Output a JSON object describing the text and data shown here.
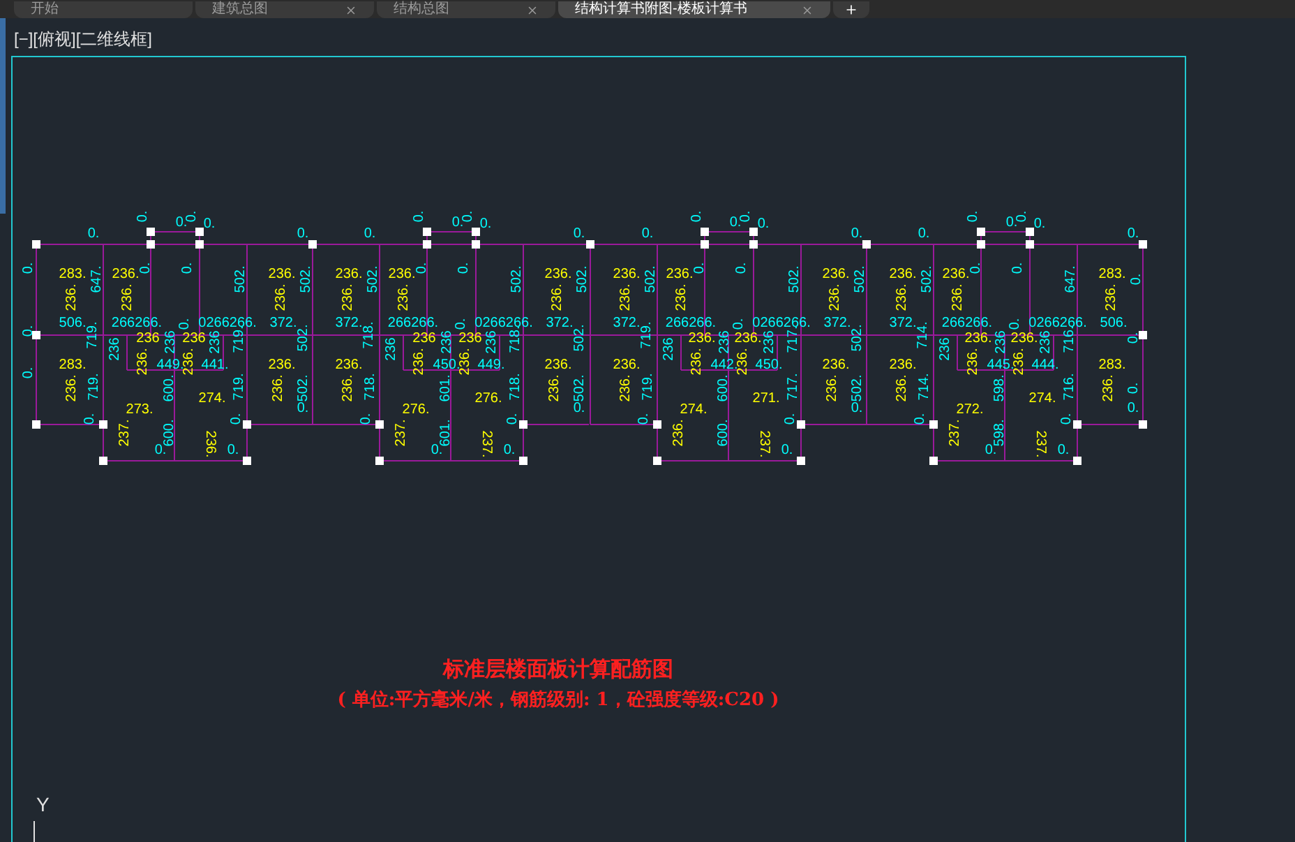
{
  "tabs": [
    {
      "label": "开始",
      "selected": false,
      "closable": false
    },
    {
      "label": "建筑总图",
      "selected": false,
      "closable": true
    },
    {
      "label": "结构总图",
      "selected": false,
      "closable": true
    },
    {
      "label": "结构计算书附图-楼板计算书",
      "selected": true,
      "closable": true
    }
  ],
  "viewport": {
    "label": "[−][俯视][二维线框]"
  },
  "drawing": {
    "units": [
      {
        "labels": [
          {
            "text": "283.",
            "kind": "required"
          },
          {
            "text": "236.",
            "kind": "required"
          },
          {
            "text": "506.",
            "kind": "provided"
          },
          {
            "text": "283.",
            "kind": "required"
          },
          {
            "text": "236.",
            "kind": "required"
          },
          {
            "text": "0.",
            "kind": "provided"
          },
          {
            "text": "647.",
            "kind": "provided"
          },
          {
            "text": "719.",
            "kind": "provided"
          },
          {
            "text": "719.",
            "kind": "provided"
          },
          {
            "text": "0.",
            "kind": "provided"
          },
          {
            "text": "236.",
            "kind": "required"
          },
          {
            "text": "236.",
            "kind": "required"
          },
          {
            "text": "0.",
            "kind": "provided"
          },
          {
            "text": "0.",
            "kind": "provided"
          },
          {
            "text": "0.",
            "kind": "provided"
          },
          {
            "text": "0.",
            "kind": "provided"
          },
          {
            "text": "0.",
            "kind": "provided"
          },
          {
            "text": "0.",
            "kind": "provided"
          },
          {
            "text": "266266.",
            "kind": "provided"
          },
          {
            "text": "0.",
            "kind": "provided"
          },
          {
            "text": "0266266.",
            "kind": "provided"
          },
          {
            "text": "236",
            "kind": "required"
          },
          {
            "text": "236",
            "kind": "required"
          },
          {
            "text": "236",
            "kind": "provided"
          },
          {
            "text": "236",
            "kind": "provided"
          },
          {
            "text": "236",
            "kind": "provided"
          },
          {
            "text": "236.",
            "kind": "required"
          },
          {
            "text": "449.",
            "kind": "provided"
          },
          {
            "text": "236.",
            "kind": "required"
          },
          {
            "text": "441.",
            "kind": "provided"
          },
          {
            "text": "600.",
            "kind": "provided"
          },
          {
            "text": "273.",
            "kind": "required"
          },
          {
            "text": "274.",
            "kind": "required"
          },
          {
            "text": "237.",
            "kind": "required"
          },
          {
            "text": "600.",
            "kind": "provided"
          },
          {
            "text": "236.",
            "kind": "required"
          },
          {
            "text": "0.",
            "kind": "provided"
          },
          {
            "text": "0.",
            "kind": "provided"
          },
          {
            "text": "719.",
            "kind": "provided"
          },
          {
            "text": "719.",
            "kind": "provided"
          },
          {
            "text": "0.",
            "kind": "provided"
          },
          {
            "text": "502.",
            "kind": "provided"
          },
          {
            "text": "236.",
            "kind": "required"
          },
          {
            "text": "236.",
            "kind": "required"
          },
          {
            "text": "372.",
            "kind": "provided"
          },
          {
            "text": "236.",
            "kind": "required"
          },
          {
            "text": "236.",
            "kind": "required"
          },
          {
            "text": "502.",
            "kind": "provided"
          },
          {
            "text": "0.",
            "kind": "provided"
          },
          {
            "text": "502.",
            "kind": "provided"
          },
          {
            "text": "502.",
            "kind": "provided"
          },
          {
            "text": "0.",
            "kind": "provided"
          },
          {
            "text": "0.",
            "kind": "provided"
          },
          {
            "text": "0.",
            "kind": "provided"
          },
          {
            "text": "0.",
            "kind": "provided"
          }
        ]
      },
      {
        "labels": [
          {
            "text": "236.",
            "kind": "required"
          },
          {
            "text": "236.",
            "kind": "required"
          },
          {
            "text": "372.",
            "kind": "provided"
          },
          {
            "text": "236.",
            "kind": "required"
          },
          {
            "text": "236.",
            "kind": "required"
          },
          {
            "text": "0.",
            "kind": "provided"
          },
          {
            "text": "502.",
            "kind": "provided"
          },
          {
            "text": "718.",
            "kind": "provided"
          },
          {
            "text": "718.",
            "kind": "provided"
          },
          {
            "text": "0.",
            "kind": "provided"
          },
          {
            "text": "236.",
            "kind": "required"
          },
          {
            "text": "236.",
            "kind": "required"
          },
          {
            "text": "0.",
            "kind": "provided"
          },
          {
            "text": "0.",
            "kind": "provided"
          },
          {
            "text": "0.",
            "kind": "provided"
          },
          {
            "text": "0.",
            "kind": "provided"
          },
          {
            "text": "0.",
            "kind": "provided"
          },
          {
            "text": "0.",
            "kind": "provided"
          },
          {
            "text": "266266.",
            "kind": "provided"
          },
          {
            "text": "0.",
            "kind": "provided"
          },
          {
            "text": "0266266.",
            "kind": "provided"
          },
          {
            "text": "236",
            "kind": "required"
          },
          {
            "text": "236",
            "kind": "required"
          },
          {
            "text": "236",
            "kind": "provided"
          },
          {
            "text": "236",
            "kind": "provided"
          },
          {
            "text": "236",
            "kind": "provided"
          },
          {
            "text": "236.",
            "kind": "required"
          },
          {
            "text": "450.",
            "kind": "provided"
          },
          {
            "text": "236.",
            "kind": "required"
          },
          {
            "text": "449.",
            "kind": "provided"
          },
          {
            "text": "601.",
            "kind": "provided"
          },
          {
            "text": "276.",
            "kind": "required"
          },
          {
            "text": "276.",
            "kind": "required"
          },
          {
            "text": "237.",
            "kind": "required"
          },
          {
            "text": "601.",
            "kind": "provided"
          },
          {
            "text": "237.",
            "kind": "required"
          },
          {
            "text": "0.",
            "kind": "provided"
          },
          {
            "text": "0.",
            "kind": "provided"
          },
          {
            "text": "718.",
            "kind": "provided"
          },
          {
            "text": "718.",
            "kind": "provided"
          },
          {
            "text": "0.",
            "kind": "provided"
          },
          {
            "text": "502.",
            "kind": "provided"
          },
          {
            "text": "236.",
            "kind": "required"
          },
          {
            "text": "236.",
            "kind": "required"
          },
          {
            "text": "372.",
            "kind": "provided"
          },
          {
            "text": "236.",
            "kind": "required"
          },
          {
            "text": "236.",
            "kind": "required"
          },
          {
            "text": "502.",
            "kind": "provided"
          },
          {
            "text": "0.",
            "kind": "provided"
          },
          {
            "text": "502.",
            "kind": "provided"
          },
          {
            "text": "502.",
            "kind": "provided"
          },
          {
            "text": "0.",
            "kind": "provided"
          }
        ]
      },
      {
        "labels": [
          {
            "text": "236.",
            "kind": "required"
          },
          {
            "text": "236.",
            "kind": "required"
          },
          {
            "text": "372.",
            "kind": "provided"
          },
          {
            "text": "236.",
            "kind": "required"
          },
          {
            "text": "236.",
            "kind": "required"
          },
          {
            "text": "0.",
            "kind": "provided"
          },
          {
            "text": "502.",
            "kind": "provided"
          },
          {
            "text": "719.",
            "kind": "provided"
          },
          {
            "text": "719.",
            "kind": "provided"
          },
          {
            "text": "0.",
            "kind": "provided"
          },
          {
            "text": "236.",
            "kind": "required"
          },
          {
            "text": "236.",
            "kind": "required"
          },
          {
            "text": "0.",
            "kind": "provided"
          },
          {
            "text": "0.",
            "kind": "provided"
          },
          {
            "text": "0.",
            "kind": "provided"
          },
          {
            "text": "0.",
            "kind": "provided"
          },
          {
            "text": "0.",
            "kind": "provided"
          },
          {
            "text": "0.",
            "kind": "provided"
          },
          {
            "text": "266266.",
            "kind": "provided"
          },
          {
            "text": "0.",
            "kind": "provided"
          },
          {
            "text": "0266266.",
            "kind": "provided"
          },
          {
            "text": "236.",
            "kind": "required"
          },
          {
            "text": "236.",
            "kind": "required"
          },
          {
            "text": "236",
            "kind": "provided"
          },
          {
            "text": "236",
            "kind": "provided"
          },
          {
            "text": "236",
            "kind": "provided"
          },
          {
            "text": "236.",
            "kind": "required"
          },
          {
            "text": "442.",
            "kind": "provided"
          },
          {
            "text": "236.",
            "kind": "required"
          },
          {
            "text": "450.",
            "kind": "provided"
          },
          {
            "text": "600.",
            "kind": "provided"
          },
          {
            "text": "274.",
            "kind": "required"
          },
          {
            "text": "271.",
            "kind": "required"
          },
          {
            "text": "236.",
            "kind": "required"
          },
          {
            "text": "600.",
            "kind": "provided"
          },
          {
            "text": "237.",
            "kind": "required"
          },
          {
            "text": "0.",
            "kind": "provided"
          },
          {
            "text": "717.",
            "kind": "provided"
          },
          {
            "text": "717.",
            "kind": "provided"
          },
          {
            "text": "0.",
            "kind": "provided"
          },
          {
            "text": "502.",
            "kind": "provided"
          },
          {
            "text": "236.",
            "kind": "required"
          },
          {
            "text": "236.",
            "kind": "required"
          },
          {
            "text": "372.",
            "kind": "provided"
          },
          {
            "text": "236.",
            "kind": "required"
          },
          {
            "text": "236.",
            "kind": "required"
          },
          {
            "text": "502.",
            "kind": "provided"
          },
          {
            "text": "0.",
            "kind": "provided"
          },
          {
            "text": "502.",
            "kind": "provided"
          },
          {
            "text": "502.",
            "kind": "provided"
          },
          {
            "text": "0.",
            "kind": "provided"
          }
        ]
      },
      {
        "labels": [
          {
            "text": "236.",
            "kind": "required"
          },
          {
            "text": "236.",
            "kind": "required"
          },
          {
            "text": "372.",
            "kind": "provided"
          },
          {
            "text": "236.",
            "kind": "required"
          },
          {
            "text": "236.",
            "kind": "required"
          },
          {
            "text": "0.",
            "kind": "provided"
          },
          {
            "text": "502.",
            "kind": "provided"
          },
          {
            "text": "714.",
            "kind": "provided"
          },
          {
            "text": "714.",
            "kind": "provided"
          },
          {
            "text": "0.",
            "kind": "provided"
          },
          {
            "text": "236.",
            "kind": "required"
          },
          {
            "text": "236.",
            "kind": "required"
          },
          {
            "text": "0.",
            "kind": "provided"
          },
          {
            "text": "0.",
            "kind": "provided"
          },
          {
            "text": "0.",
            "kind": "provided"
          },
          {
            "text": "0.",
            "kind": "provided"
          },
          {
            "text": "0.",
            "kind": "provided"
          },
          {
            "text": "0.",
            "kind": "provided"
          },
          {
            "text": "266266.",
            "kind": "provided"
          },
          {
            "text": "0.",
            "kind": "provided"
          },
          {
            "text": "0266266.",
            "kind": "provided"
          },
          {
            "text": "236.",
            "kind": "required"
          },
          {
            "text": "236.",
            "kind": "required"
          },
          {
            "text": "236",
            "kind": "provided"
          },
          {
            "text": "236",
            "kind": "provided"
          },
          {
            "text": "236",
            "kind": "provided"
          },
          {
            "text": "236.",
            "kind": "required"
          },
          {
            "text": "445.",
            "kind": "provided"
          },
          {
            "text": "236.",
            "kind": "required"
          },
          {
            "text": "444.",
            "kind": "provided"
          },
          {
            "text": "598.",
            "kind": "provided"
          },
          {
            "text": "272.",
            "kind": "required"
          },
          {
            "text": "274.",
            "kind": "required"
          },
          {
            "text": "237.",
            "kind": "required"
          },
          {
            "text": "598.",
            "kind": "provided"
          },
          {
            "text": "237.",
            "kind": "required"
          },
          {
            "text": "0.",
            "kind": "provided"
          },
          {
            "text": "0.",
            "kind": "provided"
          },
          {
            "text": "716.",
            "kind": "provided"
          },
          {
            "text": "716.",
            "kind": "provided"
          },
          {
            "text": "0.",
            "kind": "provided"
          },
          {
            "text": "647.",
            "kind": "provided"
          },
          {
            "text": "283.",
            "kind": "required"
          },
          {
            "text": "236.",
            "kind": "required"
          },
          {
            "text": "506.",
            "kind": "provided"
          },
          {
            "text": "283.",
            "kind": "required"
          },
          {
            "text": "236.",
            "kind": "required"
          },
          {
            "text": "0.",
            "kind": "provided"
          },
          {
            "text": "0.",
            "kind": "provided"
          },
          {
            "text": "0.",
            "kind": "provided"
          },
          {
            "text": "0.",
            "kind": "provided"
          },
          {
            "text": "0.",
            "kind": "provided"
          }
        ]
      }
    ],
    "title": "标准层楼面板计算配筋图",
    "subtitle": "( 单位:平方毫米/米，钢筋级别: 1，砼强度等级:C20 )"
  },
  "axis_label": "Y"
}
